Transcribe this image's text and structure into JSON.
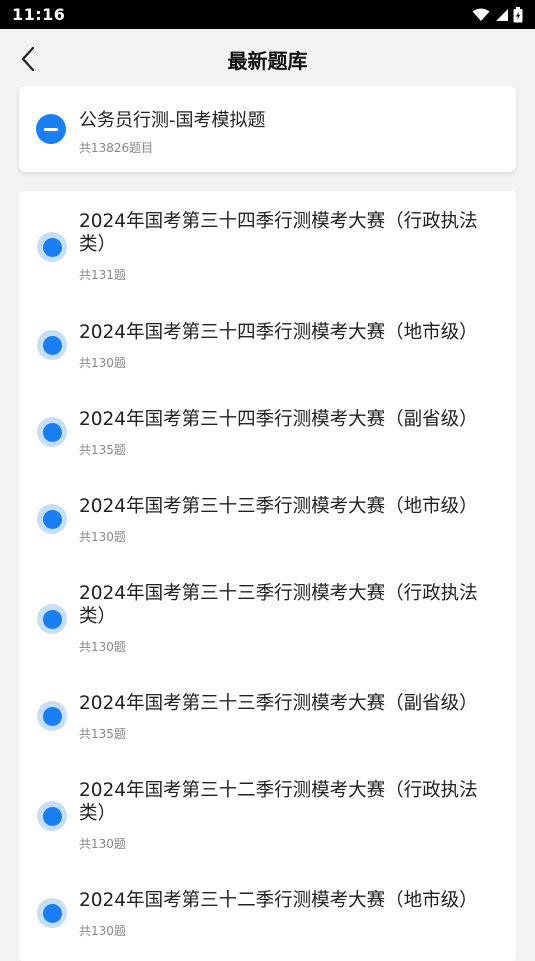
{
  "status_bar": {
    "time": "11:16",
    "icons": [
      "wifi-icon",
      "signal-icon",
      "battery-icon"
    ]
  },
  "header": {
    "title": "最新题库",
    "back_icon": "chevron-left-icon"
  },
  "bank": {
    "title": "公务员行测-国考模拟题",
    "count": "共13826题目",
    "toggle_icon": "minus-circle-icon"
  },
  "items": [
    {
      "title": "2024年国考第三十四季行测模考大赛（行政执法类）",
      "count": "共131题"
    },
    {
      "title": "2024年国考第三十四季行测模考大赛（地市级）",
      "count": "共130题"
    },
    {
      "title": "2024年国考第三十四季行测模考大赛（副省级）",
      "count": "共135题"
    },
    {
      "title": "2024年国考第三十三季行测模考大赛（地市级）",
      "count": "共130题"
    },
    {
      "title": "2024年国考第三十三季行测模考大赛（行政执法类）",
      "count": "共130题"
    },
    {
      "title": "2024年国考第三十三季行测模考大赛（副省级）",
      "count": "共135题"
    },
    {
      "title": "2024年国考第三十二季行测模考大赛（行政执法类）",
      "count": "共130题"
    },
    {
      "title": "2024年国考第三十二季行测模考大赛（地市级）",
      "count": "共130题"
    }
  ],
  "colors": {
    "accent": "#1a7ff5",
    "dot_ring": "#c7def8",
    "background": "#f2f3f5"
  }
}
